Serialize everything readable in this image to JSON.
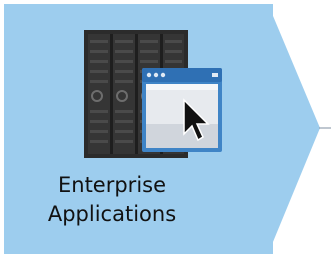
{
  "node": {
    "label_line1": "Enterprise",
    "label_line2": "Applications",
    "icon": "server-rack-with-app-window-icon"
  },
  "colors": {
    "box_fill": "#9dcdee",
    "arrow_fill": "#9dcdee",
    "connector_line": "#7f8fa0",
    "server_dark": "#2b2b2b",
    "window_frame": "#3f84c6"
  }
}
